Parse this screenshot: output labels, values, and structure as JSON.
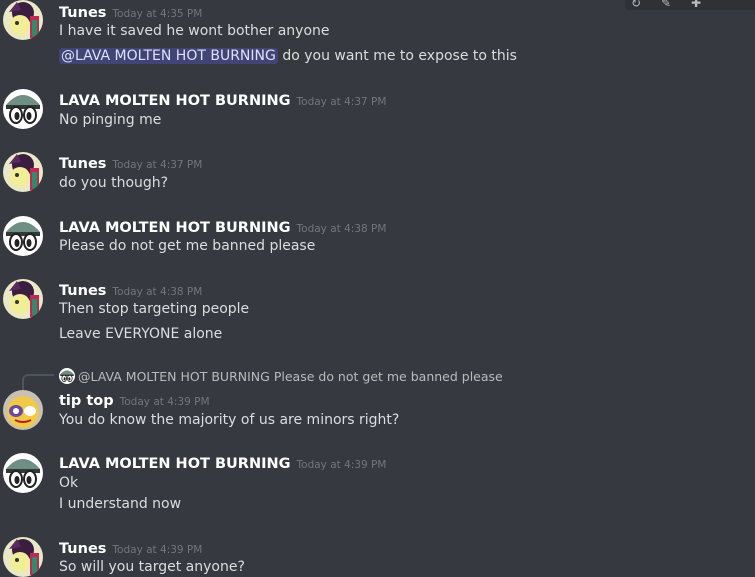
{
  "toolbar": {
    "icons": [
      "reaction-icon",
      "edit-icon",
      "thread-icon"
    ]
  },
  "messages": [
    {
      "user": "Tunes",
      "time": "Today at 4:35 PM",
      "lines": [
        "I have it saved he wont bother anyone"
      ],
      "mention": "@LAVA MOLTEN HOT BURNING",
      "mention_rest": "do you want me to expose to this"
    },
    {
      "user": "LAVA MOLTEN HOT BURNING",
      "time": "Today at 4:37 PM",
      "lines": [
        "No pinging me"
      ]
    },
    {
      "user": "Tunes",
      "time": "Today at 4:37 PM",
      "lines": [
        "do you though?"
      ]
    },
    {
      "user": "LAVA MOLTEN HOT BURNING",
      "time": "Today at 4:38 PM",
      "lines": [
        "Please do not get me banned please"
      ]
    },
    {
      "user": "Tunes",
      "time": "Today at 4:38 PM",
      "lines": [
        "Then stop targeting people",
        "Leave EVERYONE alone"
      ]
    },
    {
      "user": "tip top",
      "time": "Today at 4:39 PM",
      "lines": [
        "You do know the majority of us are minors right?"
      ],
      "reply": {
        "user": "@LAVA MOLTEN HOT BURNING",
        "text": "Please do not get me banned please"
      }
    },
    {
      "user": "LAVA MOLTEN HOT BURNING",
      "time": "Today at 4:39 PM",
      "lines": [
        "Ok",
        "I understand now"
      ]
    },
    {
      "user": "Tunes",
      "time": "Today at 4:39 PM",
      "lines": [
        "So will you target anyone?"
      ]
    }
  ]
}
